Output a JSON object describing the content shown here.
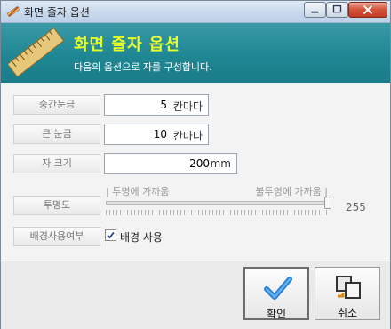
{
  "window": {
    "title": "화면 줄자 옵션"
  },
  "header": {
    "title": "화면 줄자 옵션",
    "subtitle": "다음의 옵션으로 자를 구성합니다."
  },
  "fields": {
    "middle_tick": {
      "label": "중간눈금",
      "value": "5",
      "unit": "칸마다"
    },
    "large_tick": {
      "label": "큰 눈금",
      "value": "10",
      "unit": "칸마다"
    },
    "ruler_size": {
      "label": "자 크기",
      "value": "200",
      "unit": "mm"
    },
    "transparency": {
      "label": "투명도",
      "left_label": "| 투명에 가까움",
      "right_label": "불투명에 가까움 |",
      "value": "255",
      "level": 1.0
    },
    "background": {
      "label": "배경사용여부",
      "checkbox_label": "배경 사용",
      "checked": true
    }
  },
  "buttons": {
    "ok": "확인",
    "cancel": "취소"
  },
  "icons": {
    "app": "ruler-pencil-icon",
    "header": "ruler-icon",
    "ok": "checkmark-icon",
    "cancel": "cancel-icon"
  },
  "colors": {
    "header_bg": "#1f8793",
    "header_title": "#e8ff2a",
    "check_blue": "#2b7fd6"
  }
}
